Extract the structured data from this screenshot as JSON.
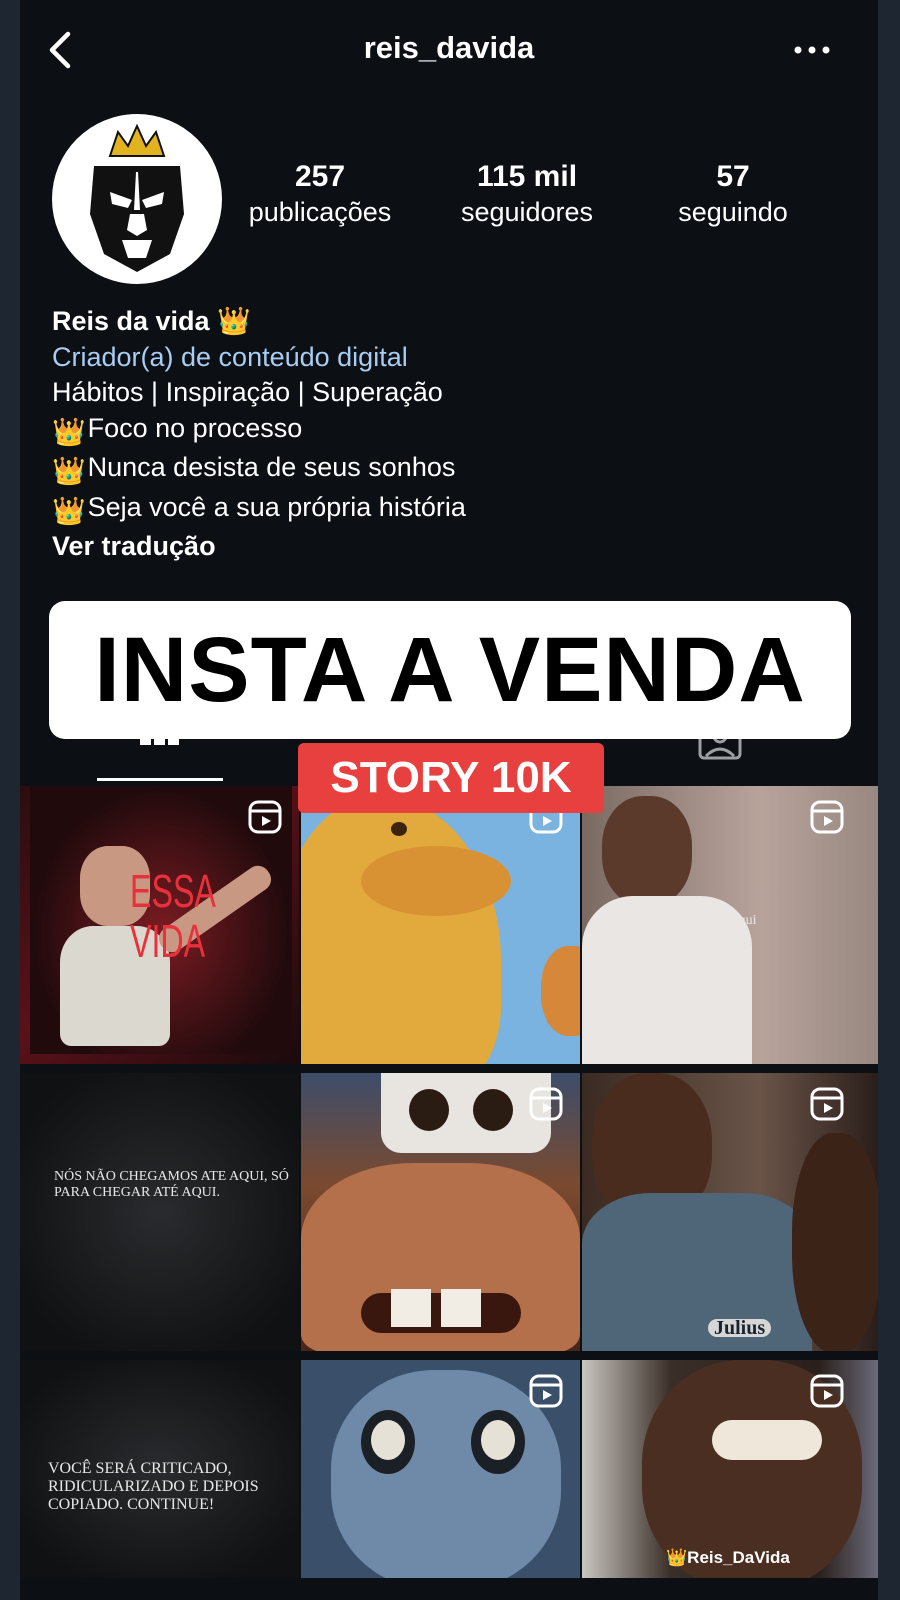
{
  "header": {
    "username": "reis_davida"
  },
  "profile": {
    "stats": [
      {
        "value": "257",
        "label": "publicações"
      },
      {
        "value": "115 mil",
        "label": "seguidores"
      },
      {
        "value": "57",
        "label": "seguindo"
      }
    ],
    "name": "Reis da vida 👑",
    "category": "Criador(a) de conteúdo digital",
    "bio_lines": [
      "Hábitos | Inspiração | Superação",
      "Foco no processo",
      "Nunca desista de seus sonhos",
      "Seja você a sua própria história"
    ],
    "see_translation": "Ver tradução"
  },
  "overlay": {
    "banner": "INSTA A VENDA",
    "badge": "STORY 10K"
  },
  "grid": {
    "captions": {
      "c1": "ESSA VIDA",
      "c3": "Eu entrei aqui",
      "c4": "NÓS NÃO CHEGAMOS ATE AQUI, SÓ PARA CHEGAR ATÉ AQUI.",
      "c6": "Julius",
      "c7": "VOCÊ SERÁ CRITICADO, RIDICULARIZADO E DEPOIS COPIADO. CONTINUE!",
      "c9": "👑Reis_DaVida"
    }
  },
  "colors": {
    "background": "#0c0f14",
    "link": "#a8cdf2",
    "badge": "#e8403f"
  }
}
